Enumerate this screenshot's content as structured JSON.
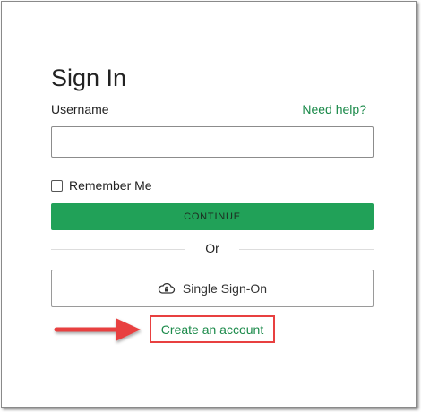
{
  "form": {
    "title": "Sign In",
    "username_label": "Username",
    "help_link": "Need help?",
    "username_value": "",
    "remember_label": "Remember Me",
    "remember_checked": false,
    "continue_label": "CONTINUE",
    "divider_text": "Or",
    "sso_label": "Single Sign-On",
    "sso_icon": "cloud-lock-icon",
    "create_account_link": "Create an account"
  },
  "annotation": {
    "arrow_icon": "arrow-right-icon",
    "highlight_color": "#e84040"
  },
  "colors": {
    "accent": "#21a158",
    "link": "#1b8a4a"
  }
}
